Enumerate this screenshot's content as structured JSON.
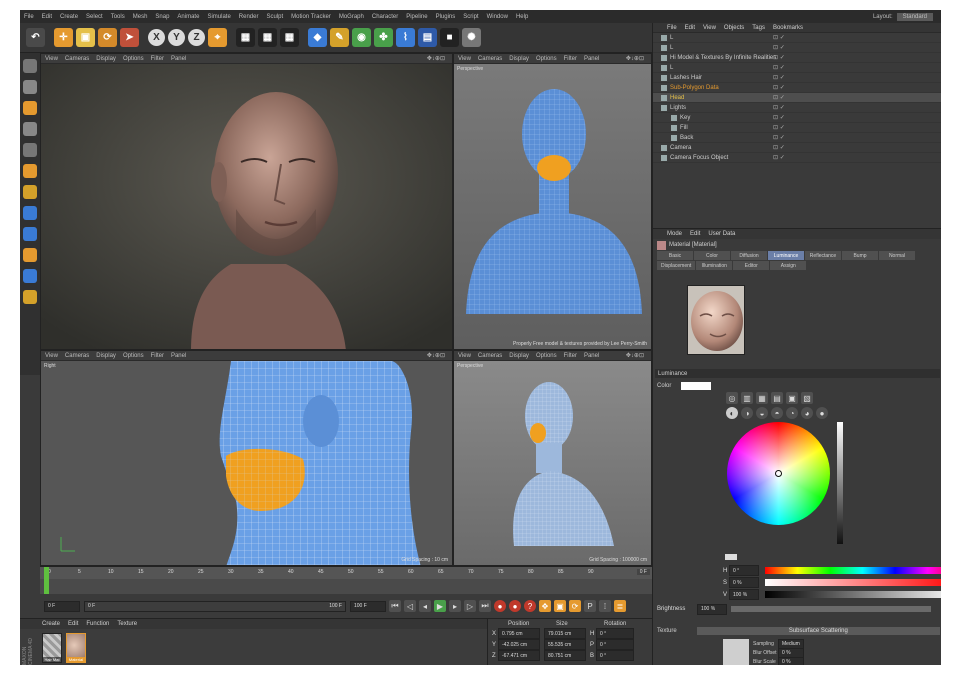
{
  "menu": [
    "File",
    "Edit",
    "Create",
    "Select",
    "Tools",
    "Mesh",
    "Snap",
    "Animate",
    "Simulate",
    "Render",
    "Sculpt",
    "Motion Tracker",
    "MoGraph",
    "Character",
    "Pipeline",
    "Plugins",
    "Script",
    "Window",
    "Help"
  ],
  "layout": {
    "label": "Layout:",
    "value": "Standard"
  },
  "toolbar": {
    "x": "X",
    "y": "Y",
    "z": "Z"
  },
  "viewport_menu": [
    "View",
    "Cameras",
    "Display",
    "Options",
    "Filter",
    "Panel"
  ],
  "viewport_ctrl": "✥↓⊕⊡",
  "viewports": {
    "top_right_label": "Perspective",
    "top_right_footer": "Properly Free model & textures provided by Lee Perry-Smith",
    "bottom_left_label": "Right",
    "bottom_left_footer": "Grid Spacing : 10 cm",
    "bottom_right_label": "Perspective",
    "bottom_right_footer": "Grid Spacing : 100000 cm"
  },
  "timeline": {
    "ticks": [
      "0",
      "5",
      "10",
      "15",
      "20",
      "25",
      "30",
      "35",
      "40",
      "45",
      "50",
      "55",
      "60",
      "65",
      "70",
      "75",
      "80",
      "85",
      "90"
    ],
    "end_label": "0 F",
    "start_field": "0 F",
    "cur_field": "0 F",
    "range_end": "100 F",
    "max_field": "100 F"
  },
  "material_manager": {
    "menu": [
      "Create",
      "Edit",
      "Function",
      "Texture"
    ],
    "brand": "MAXON CINEMA 4D",
    "materials": [
      "Hair Mat",
      "Material"
    ]
  },
  "coordinates": {
    "headers": [
      "Position",
      "Size",
      "Rotation"
    ],
    "rows": [
      {
        "axis": "X",
        "pos": "0.795 cm",
        "size": "79.015 cm",
        "rot_axis": "H",
        "rot": "0 °"
      },
      {
        "axis": "Y",
        "pos": "-42.025 cm",
        "size": "55.535 cm",
        "rot_axis": "P",
        "rot": "0 °"
      },
      {
        "axis": "Z",
        "pos": "-67.471 cm",
        "size": "80.751 cm",
        "rot_axis": "B",
        "rot": "0 °"
      }
    ]
  },
  "object_manager": {
    "menu": [
      "File",
      "Edit",
      "View",
      "Objects",
      "Tags",
      "Bookmarks"
    ],
    "rows": [
      {
        "name": "L",
        "sel": false,
        "color": "#ccc"
      },
      {
        "name": "L",
        "sel": false,
        "color": "#ccc"
      },
      {
        "name": "Hi Model & Textures By Infinite Realities",
        "sel": false,
        "color": "#ccc"
      },
      {
        "name": "L",
        "sel": false,
        "color": "#ccc"
      },
      {
        "name": "Lashes Hair",
        "sel": false,
        "color": "#ccc"
      },
      {
        "name": "Sub-Polygon Data",
        "sel": false,
        "color": "#e59a2f"
      },
      {
        "name": "Head",
        "sel": true,
        "color": "#e5c04a"
      },
      {
        "name": "Lights",
        "sel": false,
        "color": "#ccc"
      },
      {
        "name": "Key",
        "sel": false,
        "color": "#ccc"
      },
      {
        "name": "Fill",
        "sel": false,
        "color": "#ccc"
      },
      {
        "name": "Back",
        "sel": false,
        "color": "#ccc"
      },
      {
        "name": "Camera",
        "sel": false,
        "color": "#ccc"
      },
      {
        "name": "Camera Focus Object",
        "sel": false,
        "color": "#ccc"
      }
    ]
  },
  "attributes": {
    "menu": [
      "Mode",
      "Edit",
      "User Data"
    ],
    "title": "Material [Material]",
    "tabs": [
      "Basic",
      "Color",
      "Diffusion",
      "Luminance",
      "Reflectance",
      "Bump",
      "Normal",
      "Displacement",
      "Illumination",
      "Editor",
      "Assign"
    ],
    "active_tab": "Luminance",
    "section": "Luminance",
    "color_label": "Color",
    "h_label": "H",
    "h_value": "0 °",
    "s_label": "S",
    "s_value": "0 %",
    "v_label": "V",
    "v_value": "100 %",
    "brightness_label": "Brightness",
    "brightness_value": "100 %",
    "texture_label": "Texture",
    "texture_value": "Subsurface Scattering",
    "sampling_label": "Sampling",
    "sampling_value": "Medium",
    "blur_offset_label": "Blur Offset",
    "blur_offset_value": "0 %",
    "blur_scale_label": "Blur Scale",
    "blur_scale_value": "0 %"
  },
  "colors": {
    "accent": "#e59a2f",
    "active_tab": "#6b7fa8",
    "wire_blue": "#5b8fd6",
    "wire_orange": "#f0a020"
  }
}
